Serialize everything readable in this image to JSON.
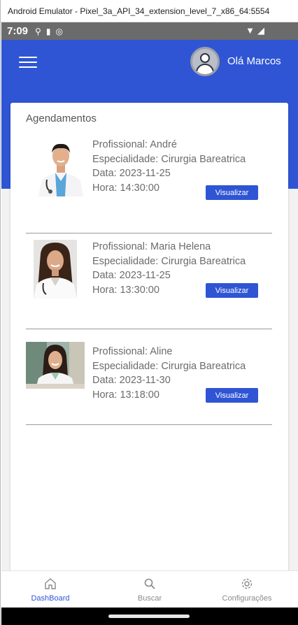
{
  "window": {
    "title": "Android Emulator - Pixel_3a_API_34_extension_level_7_x86_64:5554"
  },
  "statusbar": {
    "time": "7:09"
  },
  "header": {
    "greeting": "Olá Marcos"
  },
  "section": {
    "title": "Agendamentos"
  },
  "appointments": [
    {
      "professional": "Profissional: André",
      "specialty": "Especialidade: Cirurgia Bareatrica",
      "date": "Data: 2023-11-25",
      "time": "Hora: 14:30:00",
      "button": "Visualizar"
    },
    {
      "professional": "Profissional: Maria Helena",
      "specialty": "Especialidade: Cirurgia Bareatrica",
      "date": "Data: 2023-11-25",
      "time": "Hora: 13:30:00",
      "button": "Visualizar"
    },
    {
      "professional": "Profissional: Aline",
      "specialty": "Especialidade: Cirurgia Bareatrica",
      "date": "Data: 2023-11-30",
      "time": "Hora: 13:18:00",
      "button": "Visualizar"
    }
  ],
  "nav": {
    "items": [
      {
        "label": "DashBoard",
        "icon": "home-icon",
        "active": true
      },
      {
        "label": "Buscar",
        "icon": "search-icon",
        "active": false
      },
      {
        "label": "Configurações",
        "icon": "gear-icon",
        "active": false
      }
    ]
  },
  "colors": {
    "primary": "#2f55d4",
    "background": "#f2f2f2",
    "text": "#6b6b6b"
  }
}
